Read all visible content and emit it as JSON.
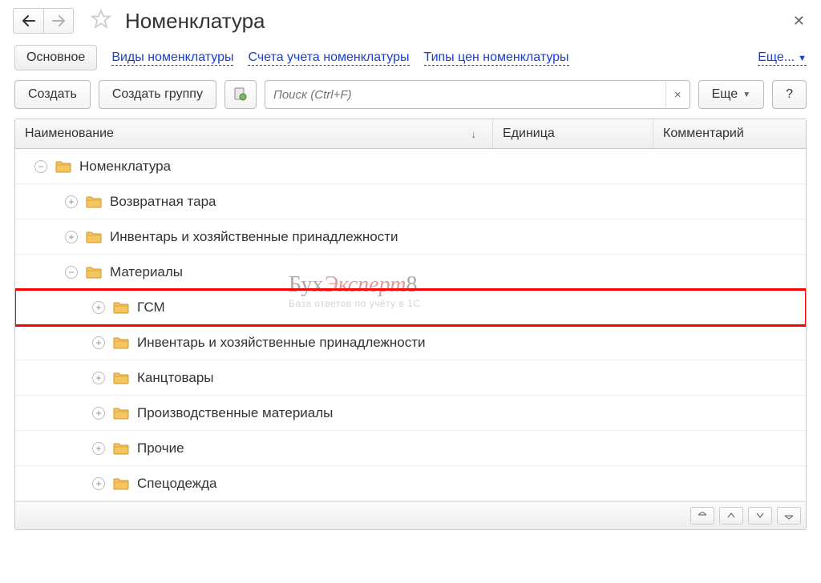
{
  "header": {
    "title": "Номенклатура"
  },
  "tabs": {
    "main": "Основное",
    "links": [
      "Виды номенклатуры",
      "Счета учета номенклатуры",
      "Типы цен номенклатуры"
    ],
    "more": "Еще..."
  },
  "toolbar": {
    "create": "Создать",
    "create_group": "Создать группу",
    "more": "Еще",
    "help": "?"
  },
  "search": {
    "placeholder": "Поиск (Ctrl+F)",
    "clear": "×"
  },
  "columns": {
    "name": "Наименование",
    "unit": "Единица",
    "comment": "Комментарий"
  },
  "tree": [
    {
      "level": 0,
      "expander": "−",
      "label": "Номенклатура"
    },
    {
      "level": 1,
      "expander": "+",
      "label": "Возвратная тара"
    },
    {
      "level": 1,
      "expander": "+",
      "label": "Инвентарь и хозяйственные принадлежности"
    },
    {
      "level": 1,
      "expander": "−",
      "label": "Материалы"
    },
    {
      "level": 2,
      "expander": "+",
      "label": "ГСМ",
      "highlighted": true
    },
    {
      "level": 2,
      "expander": "+",
      "label": "Инвентарь и хозяйственные принадлежности"
    },
    {
      "level": 2,
      "expander": "+",
      "label": "Канцтовары"
    },
    {
      "level": 2,
      "expander": "+",
      "label": "Производственные материалы"
    },
    {
      "level": 2,
      "expander": "+",
      "label": "Прочие"
    },
    {
      "level": 2,
      "expander": "+",
      "label": "Спецодежда"
    }
  ],
  "watermark": {
    "title_pre": "Бух",
    "title_mid": "Эксперт",
    "title_post": "8",
    "sub": "База ответов по учёту в 1С"
  }
}
